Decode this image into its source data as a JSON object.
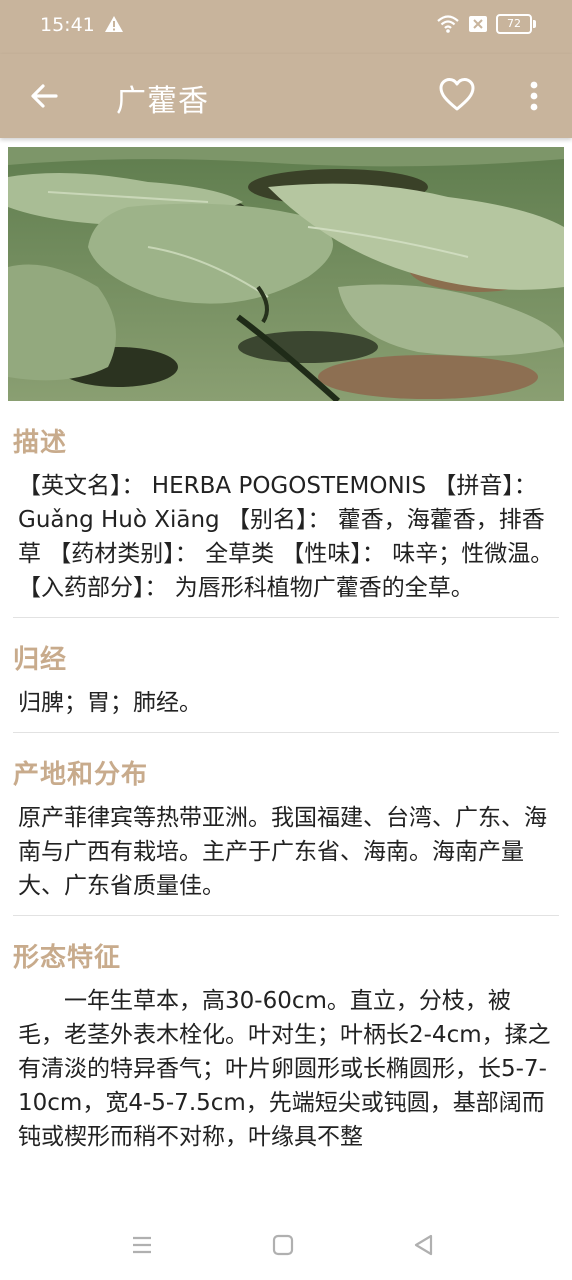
{
  "status": {
    "time": "15:41",
    "battery": "72"
  },
  "toolbar": {
    "title": "广藿香",
    "icons": [
      "back-arrow-icon",
      "heart-icon",
      "more-vert-icon"
    ]
  },
  "hero": {
    "icon": "herb-photo"
  },
  "sections": [
    {
      "title": "描述",
      "body": "【英文名】： HERBA POGOSTEMONIS 【拼音】： Guǎng Huò Xiāng 【别名】： 藿香，海藿香，排香草 【药材类别】： 全草类 【性味】： 味辛；性微温。 【入药部分】： 为唇形科植物广藿香的全草。"
    },
    {
      "title": "归经",
      "body": "归脾；胃；肺经。"
    },
    {
      "title": "产地和分布",
      "body": "原产菲律宾等热带亚洲。我国福建、台湾、广东、海南与广西有栽培。主产于广东省、海南。海南产量大、广东省质量佳。"
    },
    {
      "title": "形态特征",
      "body": "　　一年生草本，高30-60cm。直立，分枝，被毛，老茎外表木栓化。叶对生；叶柄长2-4cm，揉之有清淡的特异香气；叶片卵圆形或长椭圆形，长5-7-10cm，宽4-5-7.5cm，先端短尖或钝圆，基部阔而钝或楔形而稍不对称，叶缘具不整"
    }
  ],
  "colors": {
    "bar": "#c8b49c",
    "section_title": "#c8ab8c"
  }
}
